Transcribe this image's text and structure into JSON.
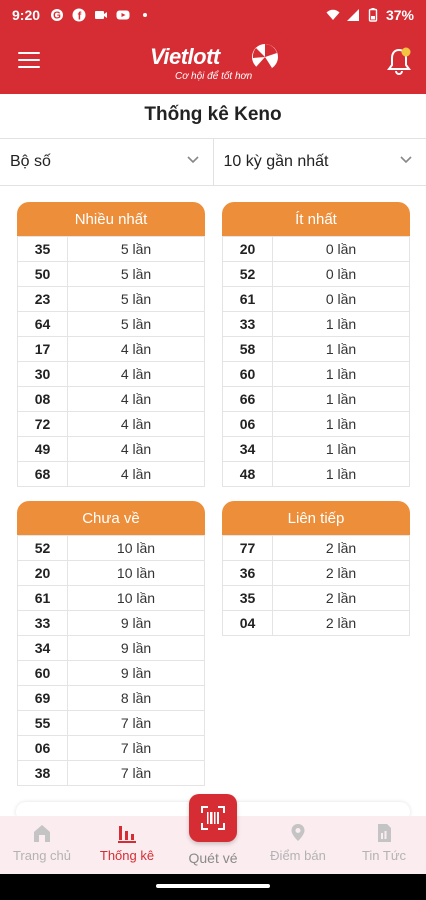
{
  "status_bar": {
    "time": "9:20",
    "battery": "37%"
  },
  "header": {
    "logo_text": "Vietlott",
    "logo_tagline": "Cơ hội để tốt hơn"
  },
  "page": {
    "title": "Thống kê Keno"
  },
  "filters": {
    "type": "Bộ số",
    "range": "10 kỳ gần nhất"
  },
  "cards": {
    "most": {
      "title": "Nhiều nhất",
      "rows": [
        {
          "num": "35",
          "count": "5 lần"
        },
        {
          "num": "50",
          "count": "5 lần"
        },
        {
          "num": "23",
          "count": "5 lần"
        },
        {
          "num": "64",
          "count": "5 lần"
        },
        {
          "num": "17",
          "count": "4 lần"
        },
        {
          "num": "30",
          "count": "4 lần"
        },
        {
          "num": "08",
          "count": "4 lần"
        },
        {
          "num": "72",
          "count": "4 lần"
        },
        {
          "num": "49",
          "count": "4 lần"
        },
        {
          "num": "68",
          "count": "4 lần"
        }
      ]
    },
    "least": {
      "title": "Ít nhất",
      "rows": [
        {
          "num": "20",
          "count": "0 lần"
        },
        {
          "num": "52",
          "count": "0 lần"
        },
        {
          "num": "61",
          "count": "0 lần"
        },
        {
          "num": "33",
          "count": "1 lần"
        },
        {
          "num": "58",
          "count": "1 lần"
        },
        {
          "num": "60",
          "count": "1 lần"
        },
        {
          "num": "66",
          "count": "1 lần"
        },
        {
          "num": "06",
          "count": "1 lần"
        },
        {
          "num": "34",
          "count": "1 lần"
        },
        {
          "num": "48",
          "count": "1 lần"
        }
      ]
    },
    "absent": {
      "title": "Chưa về",
      "rows": [
        {
          "num": "52",
          "count": "10 lần"
        },
        {
          "num": "20",
          "count": "10 lần"
        },
        {
          "num": "61",
          "count": "10 lần"
        },
        {
          "num": "33",
          "count": "9 lần"
        },
        {
          "num": "34",
          "count": "9 lần"
        },
        {
          "num": "60",
          "count": "9 lần"
        },
        {
          "num": "69",
          "count": "8 lần"
        },
        {
          "num": "55",
          "count": "7 lần"
        },
        {
          "num": "06",
          "count": "7 lần"
        },
        {
          "num": "38",
          "count": "7 lần"
        }
      ]
    },
    "consecutive": {
      "title": "Liên tiếp",
      "rows": [
        {
          "num": "77",
          "count": "2 lần"
        },
        {
          "num": "36",
          "count": "2 lần"
        },
        {
          "num": "35",
          "count": "2 lần"
        },
        {
          "num": "04",
          "count": "2 lần"
        }
      ]
    }
  },
  "bottom_nav": {
    "home": "Trang chủ",
    "stats": "Thống kê",
    "scan": "Quét vé",
    "stores": "Điểm bán",
    "news": "Tin Tức"
  },
  "colors": {
    "brand_red": "#d62d34",
    "card_orange": "#ed8e3b"
  }
}
